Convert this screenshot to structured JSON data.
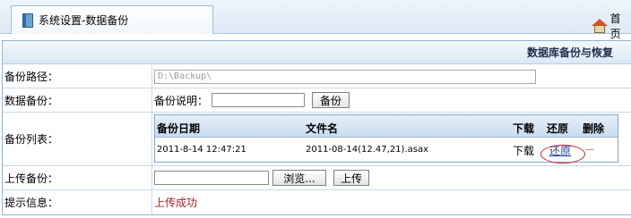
{
  "tab": {
    "title": "系统设置-数据备份",
    "icon": "book-icon"
  },
  "home": {
    "label": "首页",
    "icon": "home-icon"
  },
  "panel": {
    "title": "数据库备份与恢复"
  },
  "rows": {
    "path": {
      "label": "备份路径：",
      "value": "D:\\Backup\\"
    },
    "backup": {
      "label": "数据备份：",
      "desc_label": "备份说明：",
      "desc_value": "",
      "button": "备份"
    },
    "list": {
      "label": "备份列表：",
      "columns": {
        "date": "备份日期",
        "file": "文件名",
        "download": "下载",
        "restore": "还原",
        "delete": "删除"
      },
      "items": [
        {
          "date": "2011-8-14 12:47:21",
          "file": "2011-08-14(12.47,21).asax",
          "download": "下载",
          "restore": "还原",
          "delete": "—"
        }
      ]
    },
    "upload": {
      "label": "上传备份：",
      "browse": "浏览...",
      "button": "上传"
    },
    "info": {
      "label": "提示信息：",
      "message": "上传成功"
    }
  },
  "colors": {
    "status": "#b02020",
    "accent_border": "#8db2d8",
    "highlight_ring": "#d0202a"
  }
}
